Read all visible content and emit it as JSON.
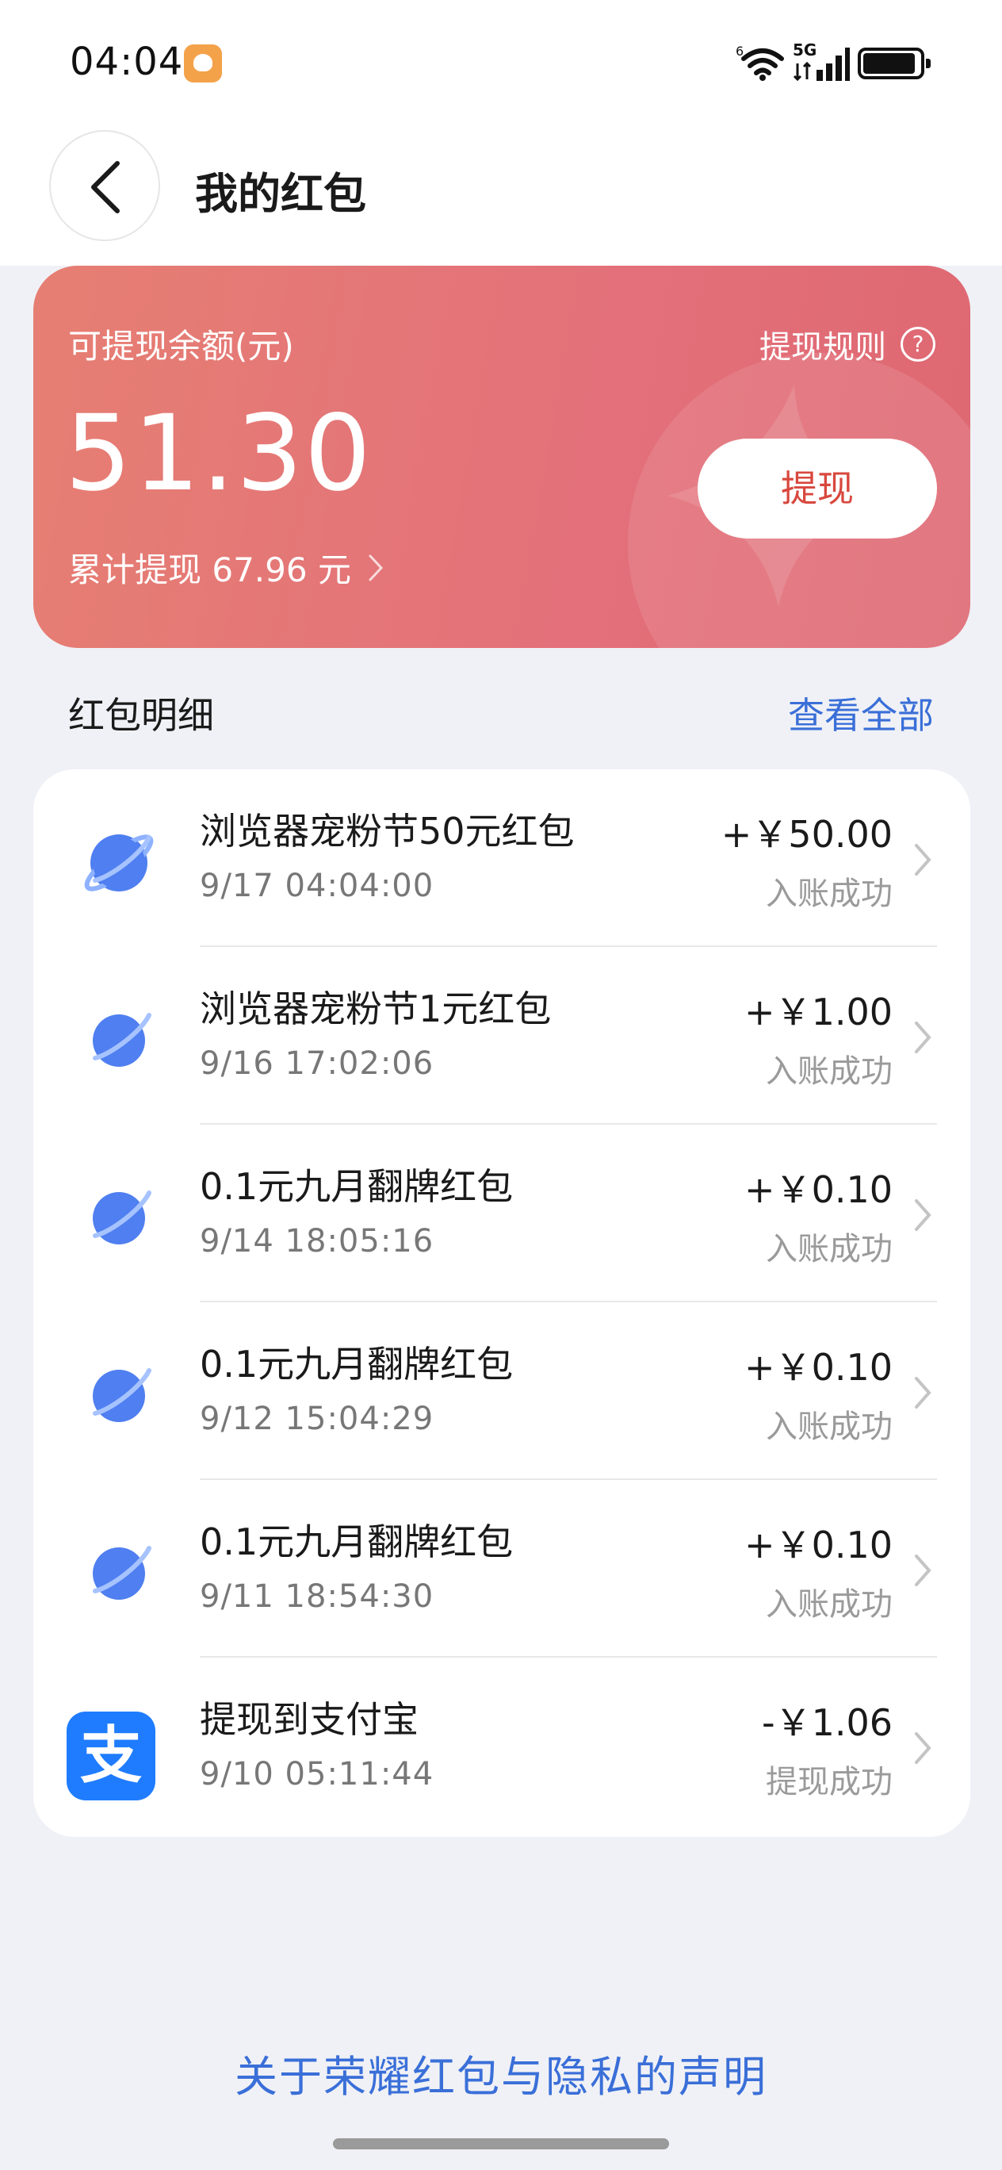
{
  "status_bar": {
    "time": "04:04",
    "wifi_label": "6",
    "network": "5G"
  },
  "header": {
    "title": "我的红包"
  },
  "balance_card": {
    "label": "可提现余额(元)",
    "rules_label": "提现规则",
    "amount": "51.30",
    "withdraw_label": "提现",
    "cumulative": "累计提现 67.96 元"
  },
  "details": {
    "title": "红包明细",
    "view_all": "查看全部",
    "items": [
      {
        "icon": "browser-planet-icon",
        "title": "浏览器宠粉节50元红包",
        "time": "9/17 04:04:00",
        "amount": "+￥50.00",
        "status": "入账成功"
      },
      {
        "icon": "browser-planet-icon",
        "title": "浏览器宠粉节1元红包",
        "time": "9/16 17:02:06",
        "amount": "+￥1.00",
        "status": "入账成功"
      },
      {
        "icon": "browser-planet-icon",
        "title": "0.1元九月翻牌红包",
        "time": "9/14 18:05:16",
        "amount": "+￥0.10",
        "status": "入账成功"
      },
      {
        "icon": "browser-planet-icon",
        "title": "0.1元九月翻牌红包",
        "time": "9/12 15:04:29",
        "amount": "+￥0.10",
        "status": "入账成功"
      },
      {
        "icon": "browser-planet-icon",
        "title": "0.1元九月翻牌红包",
        "time": "9/11 18:54:30",
        "amount": "+￥0.10",
        "status": "入账成功"
      },
      {
        "icon": "alipay-icon",
        "icon_text": "支",
        "title": "提现到支付宝",
        "time": "9/10 05:11:44",
        "amount": "-￥1.06",
        "status": "提现成功"
      }
    ]
  },
  "footer": {
    "privacy_link": "关于荣耀红包与隐私的声明"
  },
  "colors": {
    "card_gradient_start": "#e67f73",
    "card_gradient_end": "#de6872",
    "link_blue": "#3a6fd8",
    "withdraw_text": "#d8483e",
    "alipay_blue": "#1f7cff"
  }
}
